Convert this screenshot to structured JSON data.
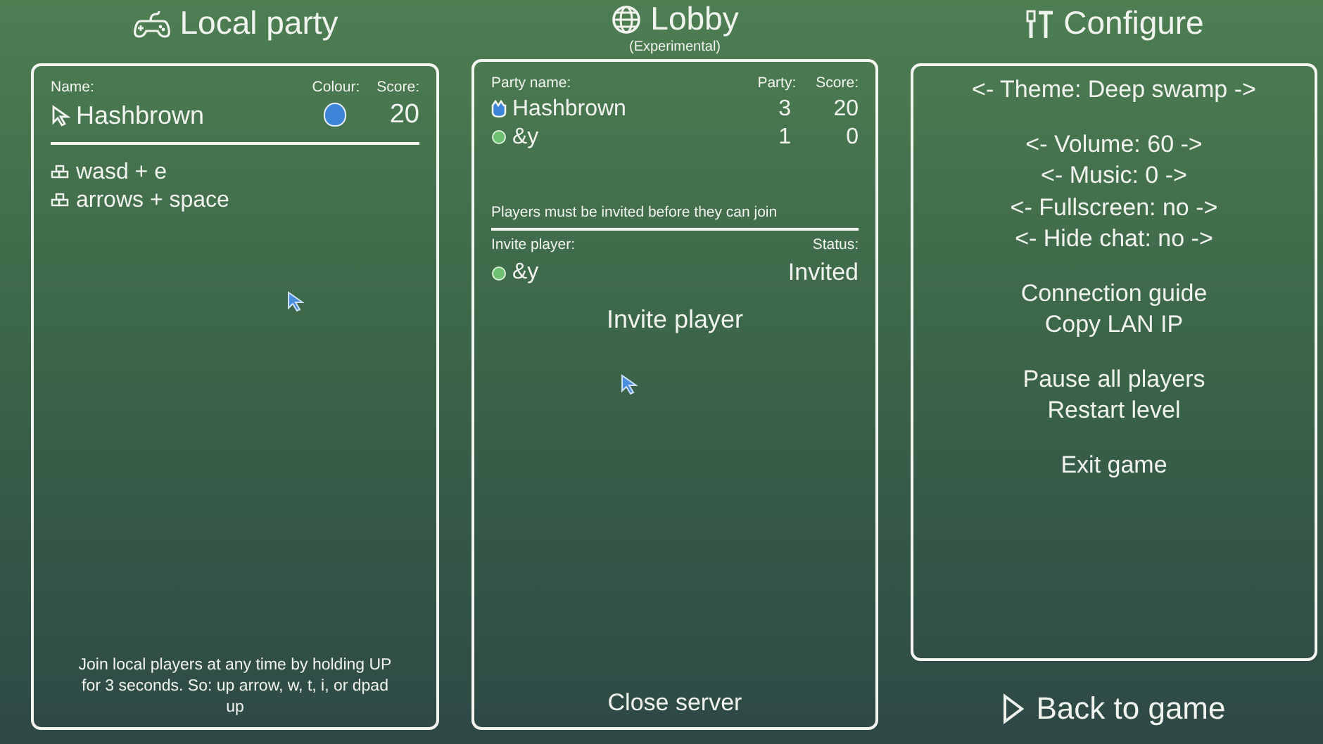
{
  "local_party": {
    "title": "Local party",
    "headers": {
      "name": "Name:",
      "colour": "Colour:",
      "score": "Score:"
    },
    "players": [
      {
        "name": "Hashbrown",
        "color": "#3d85d8",
        "score": "20"
      }
    ],
    "controls": [
      "wasd + e",
      "arrows + space"
    ],
    "hint": "Join local players at any time by holding UP for 3 seconds. So: up arrow, w, t, i, or dpad up"
  },
  "lobby": {
    "title": "Lobby",
    "subtitle": "(Experimental)",
    "headers": {
      "name": "Party name:",
      "party": "Party:",
      "score": "Score:"
    },
    "members": [
      {
        "kind": "host",
        "name": "Hashbrown",
        "party": "3",
        "score": "20",
        "color": "#3d85d8"
      },
      {
        "kind": "member",
        "name": "&y",
        "party": "1",
        "score": "0",
        "color": "#6cc070"
      }
    ],
    "notice": "Players must be invited before they can join",
    "invite_headers": {
      "player": "Invite player:",
      "status": "Status:"
    },
    "invites": [
      {
        "name": "&y",
        "status": "Invited",
        "color": "#6cc070"
      }
    ],
    "invite_button": "Invite player",
    "close_button": "Close server"
  },
  "configure": {
    "title": "Configure",
    "groups": [
      [
        "<- Theme: Deep swamp ->"
      ],
      [
        "<- Volume: 60 ->",
        "<- Music: 0 ->",
        "<- Fullscreen: no ->",
        "<- Hide chat: no ->"
      ],
      [
        "Connection guide",
        "Copy LAN IP"
      ],
      [
        "Pause all players",
        "Restart level"
      ],
      [
        "Exit game"
      ]
    ]
  },
  "back_button": "Back to game"
}
